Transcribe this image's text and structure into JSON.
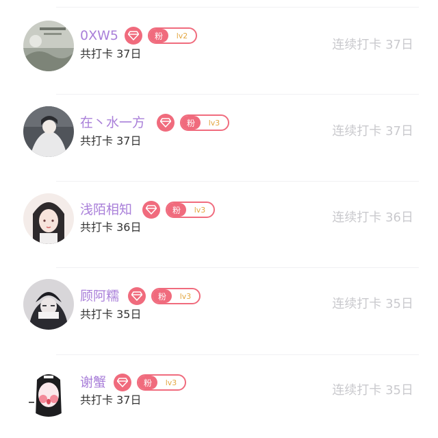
{
  "users": [
    {
      "name": "0XW5",
      "fan_badge": "粉",
      "level": "lv2",
      "total_checkin": "共打卡 37日",
      "streak": "连续打卡 37日"
    },
    {
      "name": "在丶水一方",
      "fan_badge": "粉",
      "level": "lv3",
      "total_checkin": "共打卡 37日",
      "streak": "连续打卡 37日"
    },
    {
      "name": "浅陌相知",
      "fan_badge": "粉",
      "level": "lv3",
      "total_checkin": "共打卡 36日",
      "streak": "连续打卡 36日"
    },
    {
      "name": "顾阿糯",
      "fan_badge": "粉",
      "level": "lv3",
      "total_checkin": "共打卡 35日",
      "streak": "连续打卡 35日"
    },
    {
      "name": "谢蟹",
      "fan_badge": "粉",
      "level": "lv3",
      "total_checkin": "共打卡 37日",
      "streak": "连续打卡 35日"
    }
  ],
  "colors": {
    "name": "#a97fd9",
    "badge": "#f06b7d",
    "level_text": "#e3a63f",
    "streak_text": "#c9c9cd",
    "total_text": "#333333"
  },
  "icons": {
    "vip": "diamond-icon"
  }
}
